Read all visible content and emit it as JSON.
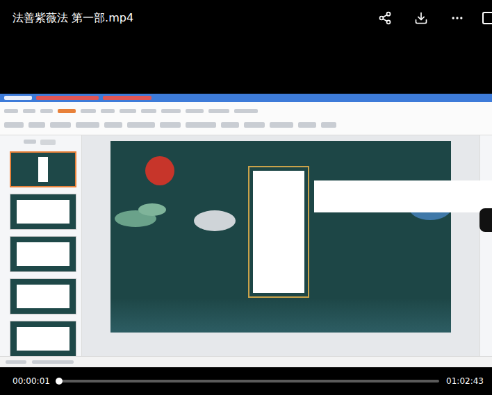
{
  "header": {
    "title": "法善紫薇法 第一部.mp4"
  },
  "player": {
    "current_time": "00:00:01",
    "duration": "01:02:43",
    "progress": {
      "level": 0.005
    }
  }
}
